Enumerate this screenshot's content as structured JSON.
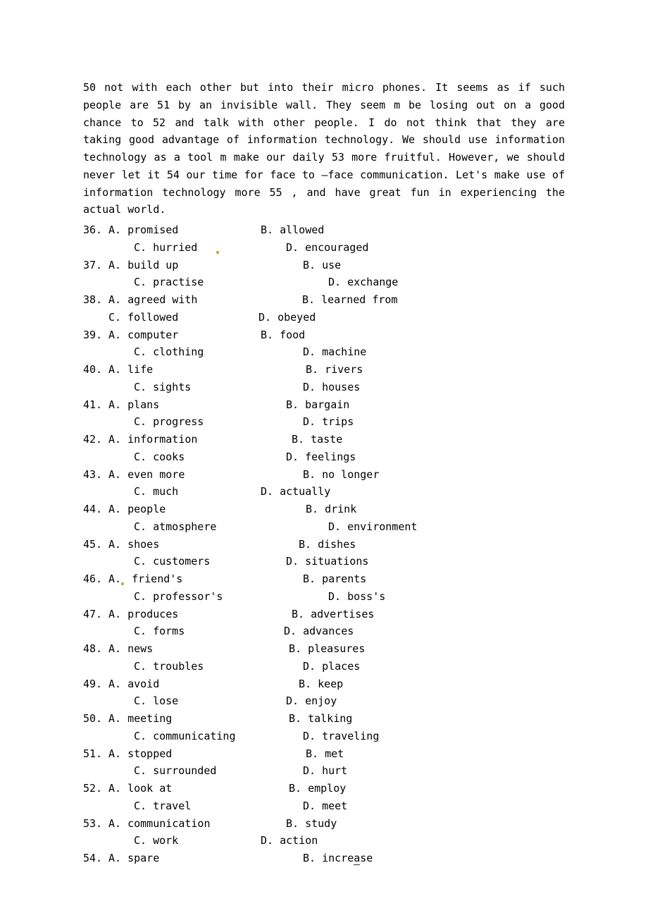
{
  "passage": "50  not with each other but into their micro phones. It seems as if such people are  51  by an invisible wall. They seem m be losing out on a good chance to  52   and talk with other people. I do not think that they are taking good advantage of information technology. We should use information technology as a tool m make our daily   53   more fruitful. However, we should never let it   54   our time for face to –face communication. Let's make use of information technology more   55  , and have great fun in experiencing the actual world.",
  "questions": [
    {
      "n": "36.",
      "a": "A. promised",
      "b": "B. allowed",
      "c": "C. hurried",
      "d": "D. encouraged",
      "off_a": 0,
      "off_b": -36,
      "off_c": 36,
      "off_d": 0,
      "dot": "c"
    },
    {
      "n": "37.",
      "a": "A. build up",
      "b": "B. use",
      "c": "C. practise",
      "d": "D. exchange",
      "off_a": 0,
      "off_b": 24,
      "off_c": 36,
      "off_d": 60
    },
    {
      "n": "38.",
      "a": "A. agreed with",
      "b": "B. learned from",
      "c": "C. followed",
      "d": "D. obeyed",
      "off_a": 0,
      "off_b": 23,
      "off_c": 0,
      "off_d": -3
    },
    {
      "n": "39.",
      "a": "A. computer",
      "b": "B. food",
      "c": "C. clothing",
      "d": "D. machine",
      "off_a": 0,
      "off_b": -36,
      "off_c": 36,
      "off_d": 24
    },
    {
      "n": "40.",
      "a": "A. life",
      "b": "B. rivers",
      "c": "C. sights",
      "d": "D. houses",
      "off_a": 0,
      "off_b": 28,
      "off_c": 36,
      "off_d": 24
    },
    {
      "n": "41.",
      "a": "A. plans",
      "b": "B. bargain",
      "c": "C. progress",
      "d": "D. trips",
      "off_a": 0,
      "off_b": 0,
      "off_c": 36,
      "off_d": 24
    },
    {
      "n": "42.",
      "a": "A. information",
      "b": "B. taste",
      "c": "C. cooks",
      "d": "D. feelings",
      "off_a": 0,
      "off_b": 8,
      "off_c": 36,
      "off_d": 0
    },
    {
      "n": "43.",
      "a": "A. even more",
      "b": "B. no longer",
      "c": "C. much",
      "d": "D. actually",
      "off_a": 0,
      "off_b": 24,
      "off_c": 36,
      "off_d": -36
    },
    {
      "n": "44.",
      "a": "A. people",
      "b": "B. drink",
      "c": "C. atmosphere",
      "d": "D. environment",
      "off_a": 0,
      "off_b": 28,
      "off_c": 36,
      "off_d": 60
    },
    {
      "n": "45.",
      "a": "A. shoes",
      "b": "B. dishes",
      "c": "C. customers",
      "d": "D. situations",
      "off_a": 0,
      "off_b": 18,
      "off_c": 36,
      "off_d": 0
    },
    {
      "n": "46.",
      "a": "A. friend's",
      "b": "B. parents",
      "c": "C. professor's",
      "d": "D. boss's",
      "off_a": 0,
      "off_b": 24,
      "off_c": 36,
      "off_d": 60,
      "dot": "a"
    },
    {
      "n": "47.",
      "a": "A. produces",
      "b": "B. advertises",
      "c": "C. forms",
      "d": "D. advances",
      "off_a": 0,
      "off_b": 8,
      "off_c": 36,
      "off_d": -3
    },
    {
      "n": "48.",
      "a": "A. news",
      "b": "B. pleasures",
      "c": "C. troubles",
      "d": "D. places",
      "off_a": 0,
      "off_b": 4,
      "off_c": 36,
      "off_d": 24
    },
    {
      "n": "49.",
      "a": "A. avoid",
      "b": "B. keep",
      "c": "C. lose",
      "d": "D. enjoy",
      "off_a": 0,
      "off_b": 18,
      "off_c": 36,
      "off_d": 0
    },
    {
      "n": "50.",
      "a": "A. meeting",
      "b": "B. talking",
      "c": "C. communicating",
      "d": "D. traveling",
      "off_a": 0,
      "off_b": 4,
      "off_c": 36,
      "off_d": 24
    },
    {
      "n": "51.",
      "a": "A. stopped",
      "b": "B. met",
      "c": "C. surrounded",
      "d": "D. hurt",
      "off_a": 0,
      "off_b": 28,
      "off_c": 36,
      "off_d": 24
    },
    {
      "n": "52.",
      "a": "A. look at",
      "b": "B. employ",
      "c": "C. travel",
      "d": "D. meet",
      "off_a": 0,
      "off_b": 4,
      "off_c": 36,
      "off_d": 24
    },
    {
      "n": "53.",
      "a": "A. communication",
      "b": "B. study",
      "c": "C. work",
      "d": "D. action",
      "off_a": 0,
      "off_b": 0,
      "off_c": 36,
      "off_d": -36
    },
    {
      "n": "54.",
      "a": "A. spare",
      "b": "B. increase",
      "c": "",
      "d": "",
      "off_a": 0,
      "off_b": 24,
      "off_c": 36,
      "off_d": 0,
      "single": true,
      "udash": true
    }
  ]
}
